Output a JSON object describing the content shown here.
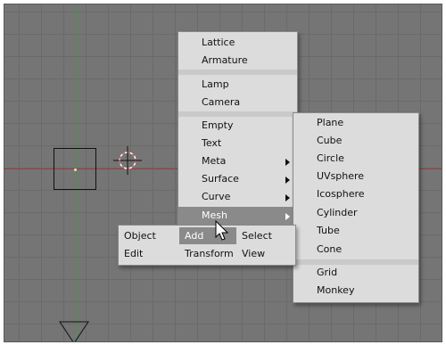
{
  "add_menu": {
    "items": [
      {
        "label": "Lattice"
      },
      {
        "label": "Armature"
      },
      {
        "label": "Lamp"
      },
      {
        "label": "Camera"
      },
      {
        "label": "Empty"
      },
      {
        "label": "Text"
      },
      {
        "label": "Meta"
      },
      {
        "label": "Surface"
      },
      {
        "label": "Curve"
      },
      {
        "label": "Mesh"
      }
    ]
  },
  "mesh_menu": {
    "items": [
      {
        "label": "Plane"
      },
      {
        "label": "Cube"
      },
      {
        "label": "Circle"
      },
      {
        "label": "UVsphere"
      },
      {
        "label": "Icosphere"
      },
      {
        "label": "Cylinder"
      },
      {
        "label": "Tube"
      },
      {
        "label": "Cone"
      },
      {
        "label": "Grid"
      },
      {
        "label": "Monkey"
      }
    ]
  },
  "header_menu": {
    "object": "Object",
    "add": "Add",
    "select": "Select",
    "edit": "Edit",
    "transform": "Transform",
    "view": "View"
  },
  "colors": {
    "viewport_bg": "#757575",
    "menu_bg": "#dcdcdc",
    "highlight": "#8a8a8a",
    "y_axis": "#3f9a3f",
    "x_axis": "#9a3f3f"
  }
}
